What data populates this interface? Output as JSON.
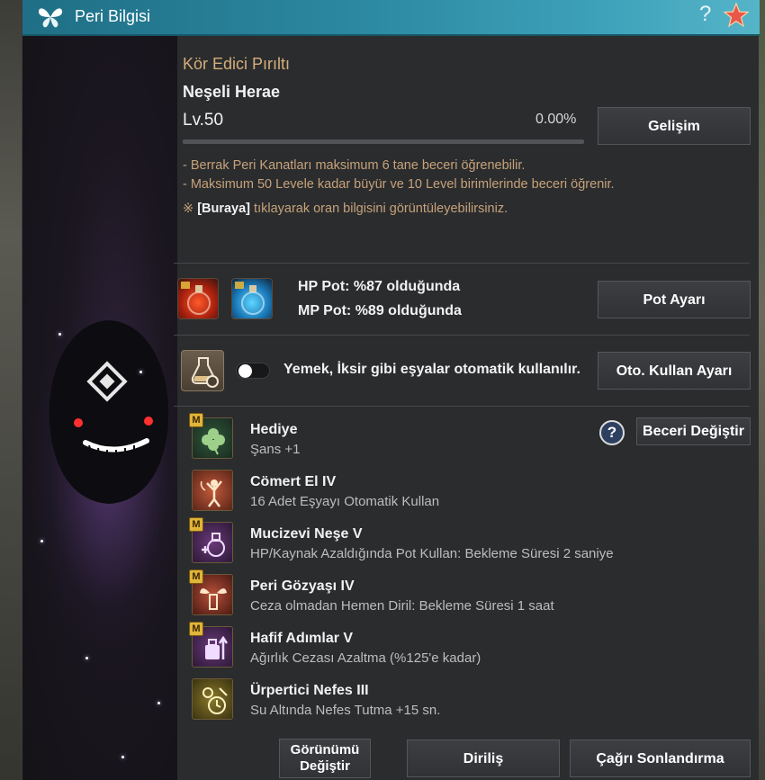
{
  "window": {
    "title": "Peri Bilgisi",
    "help_label": "?"
  },
  "pet": {
    "title": "Kör Edici Pırıltı",
    "name": "Neşeli Herae",
    "level": "Lv.50",
    "progress_text": "0.00%",
    "progress_fraction": 0.0,
    "growth_button": "Gelişim"
  },
  "notes": {
    "line1": "- Berrak Peri Kanatları maksimum 6 tane beceri öğrenebilir.",
    "line2": "- Maksimum 50 Levele kadar büyür ve 10 Level birimlerinde beceri öğrenir.",
    "link_prefix": "※ ",
    "link_text": "[Buraya]",
    "link_suffix": " tıklayarak oran bilgisini görüntüleyebilirsiniz."
  },
  "potions": {
    "hp_text": "HP Pot: %87 olduğunda",
    "mp_text": "MP Pot: %89 olduğunda",
    "button": "Pot Ayarı"
  },
  "auto_use": {
    "text": "Yemek, İksir gibi eşyalar otomatik kullanılır.",
    "toggle_on": false,
    "button": "Oto. Kullan Ayarı"
  },
  "skills": {
    "help_label": "?",
    "change_button": "Beceri Değiştir",
    "badge": "M",
    "items": [
      {
        "name": "Hediye",
        "desc": "Şans +1",
        "icon": "clover-icon",
        "badge": true
      },
      {
        "name": "Cömert El IV",
        "desc": "16 Adet Eşyayı Otomatik Kullan",
        "icon": "fairy-icon",
        "badge": false
      },
      {
        "name": "Mucizevi Neşe V",
        "desc": "HP/Kaynak Azaldığında Pot Kullan: Bekleme Süresi 2 saniye",
        "icon": "potion-plus-icon",
        "badge": true
      },
      {
        "name": "Peri Gözyaşı IV",
        "desc": "Ceza olmadan Hemen Diril: Bekleme Süresi 1 saat",
        "icon": "winged-vial-icon",
        "badge": true
      },
      {
        "name": "Hafif Adımlar V",
        "desc": "Ağırlık Cezası Azaltma (%125'e kadar)",
        "icon": "weight-icon",
        "badge": true
      },
      {
        "name": "Ürpertici Nefes III",
        "desc": "Su Altında Nefes Tutma +15 sn.",
        "icon": "breath-timer-icon",
        "badge": false
      }
    ]
  },
  "footer": {
    "appearance_line1": "Görünümü",
    "appearance_line2": "Değiştir",
    "revive": "Diriliş",
    "dismiss": "Çağrı Sonlandırma"
  },
  "colors": {
    "title_bar": "#2b88a0",
    "accent_gold": "#d2aa76",
    "badge": "#e0b53a"
  }
}
